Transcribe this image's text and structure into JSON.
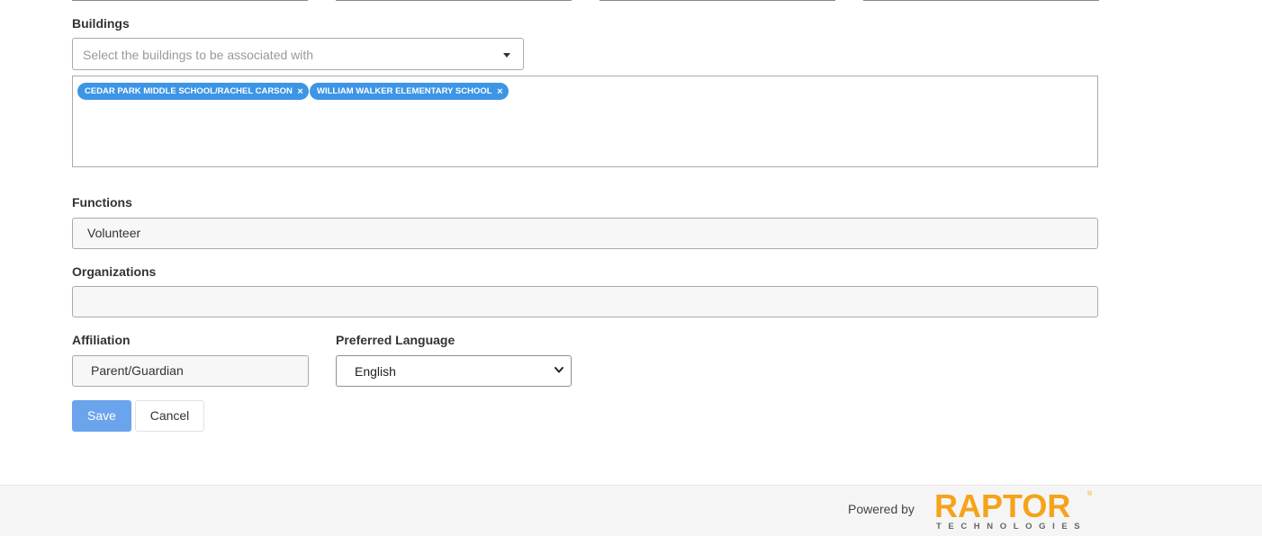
{
  "buildings": {
    "label": "Buildings",
    "placeholder": "Select the buildings to be associated with",
    "selected": [
      "CEDAR PARK MIDDLE SCHOOL/RACHEL CARSON",
      "WILLIAM WALKER ELEMENTARY SCHOOL"
    ],
    "chip_color": "#3d95e6"
  },
  "functions": {
    "label": "Functions",
    "value": "Volunteer"
  },
  "organizations": {
    "label": "Organizations",
    "value": ""
  },
  "affiliation": {
    "label": "Affiliation",
    "value": "Parent/Guardian"
  },
  "preferred_language": {
    "label": "Preferred Language",
    "value": "English"
  },
  "actions": {
    "save_label": "Save",
    "cancel_label": "Cancel",
    "save_color": "#6aa4ec"
  },
  "footer": {
    "powered_by": "Powered by",
    "logo_text": "RAPTOR",
    "logo_subtext": "TECHNOLOGIES",
    "logo_registered": "®",
    "logo_color": "#f5a31a"
  },
  "icons": {
    "dropdown_caret": "caret-down-icon",
    "chip_remove": "close-icon",
    "select_chevron": "chevron-down-icon"
  }
}
